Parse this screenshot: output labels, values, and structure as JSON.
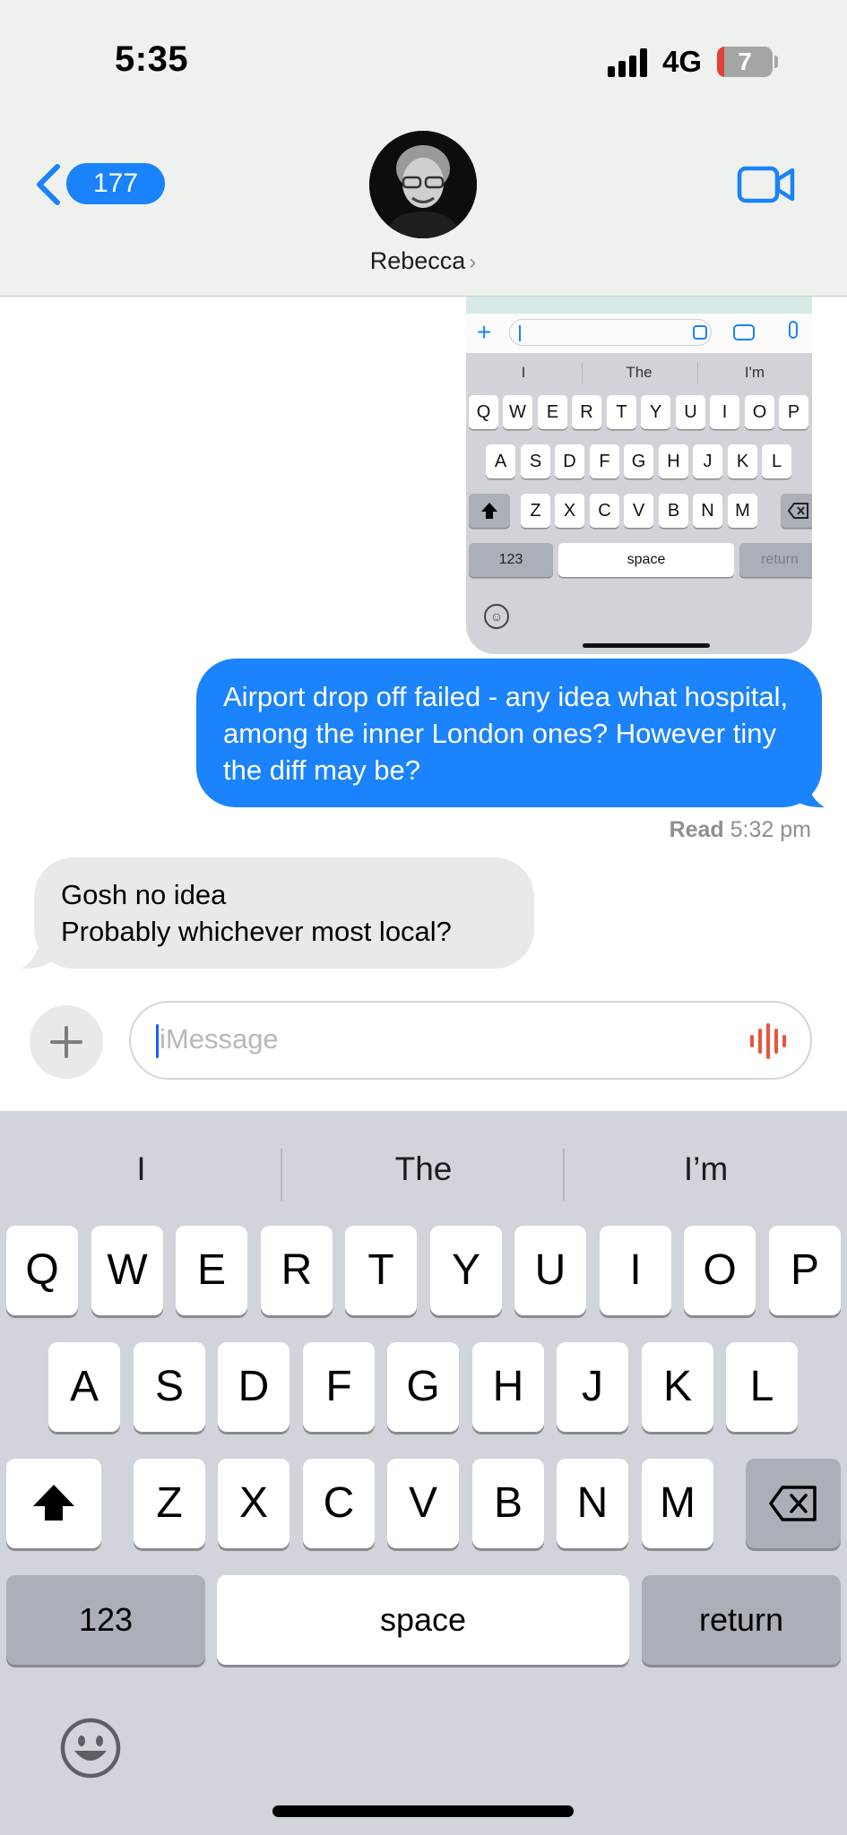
{
  "status": {
    "time": "5:35",
    "network": "4G",
    "battery": "7"
  },
  "header": {
    "back_count": "177",
    "contact_name": "Rebecca",
    "contact_chevron": "›"
  },
  "embedded_screenshot": {
    "suggestions": [
      "I",
      "The",
      "I'm"
    ],
    "rows": [
      [
        "Q",
        "W",
        "E",
        "R",
        "T",
        "Y",
        "U",
        "I",
        "O",
        "P"
      ],
      [
        "A",
        "S",
        "D",
        "F",
        "G",
        "H",
        "J",
        "K",
        "L"
      ],
      [
        "Z",
        "X",
        "C",
        "V",
        "B",
        "N",
        "M"
      ]
    ],
    "numbers_key": "123",
    "space_key": "space",
    "return_key": "return",
    "emoji": "☺"
  },
  "messages": [
    {
      "direction": "outgoing",
      "text": "Airport drop off failed - any idea what hospital, among the inner London ones? However tiny the diff may be?"
    },
    {
      "direction": "incoming",
      "lines": [
        "Gosh no idea",
        "Probably whichever most local?"
      ]
    }
  ],
  "receipt": {
    "label": "Read",
    "time": "5:32 pm"
  },
  "composer": {
    "placeholder": "iMessage"
  },
  "keyboard": {
    "suggestions": [
      "I",
      "The",
      "I’m"
    ],
    "rows": [
      [
        "Q",
        "W",
        "E",
        "R",
        "T",
        "Y",
        "U",
        "I",
        "O",
        "P"
      ],
      [
        "A",
        "S",
        "D",
        "F",
        "G",
        "H",
        "J",
        "K",
        "L"
      ],
      [
        "Z",
        "X",
        "C",
        "V",
        "B",
        "N",
        "M"
      ]
    ],
    "numbers_key": "123",
    "space_key": "space",
    "return_key": "return"
  },
  "colors": {
    "accent": "#1b83fb",
    "incoming_bubble": "#e9e9eb",
    "keyboard_bg": "#d1d4da",
    "voice_icon": "#e8553c"
  }
}
